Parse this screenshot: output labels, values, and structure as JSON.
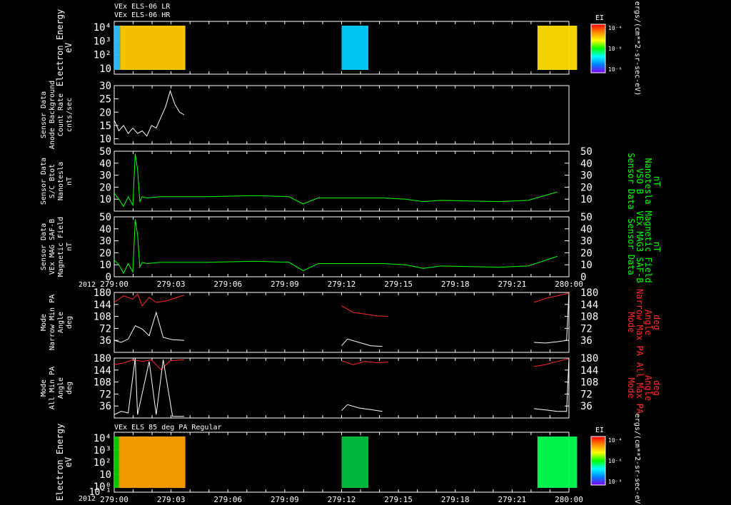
{
  "header": {
    "line1": "VEx ELS-06 LR",
    "line2": "VEx ELS-06 HR"
  },
  "bottom_title": "VEx ELS 85 deg PA Regular",
  "year_label": "2012",
  "time_ticks": [
    "279:00",
    "279:03",
    "279:06",
    "279:09",
    "279:12",
    "279:15",
    "279:18",
    "279:21",
    "280:00"
  ],
  "colorbar": {
    "title": "EI",
    "top_ticks": [
      "10⁻⁴",
      "10⁻⁶",
      "10⁻⁸"
    ],
    "bottom_ticks": [
      "10⁻⁴",
      "10⁻⁶",
      "10⁻⁸"
    ],
    "unit_label": "ergs/(cm**2-sr-sec-eV)",
    "colors": [
      "#ff0000",
      "#ff8800",
      "#ffff00",
      "#00ff00",
      "#00ffff",
      "#0080ff",
      "#8000ff"
    ]
  },
  "colors": {
    "background": "#000000",
    "axes": "#ffffff",
    "green_trace": "#00ff00",
    "red_trace": "#ff2a2a",
    "white_trace": "#ffffff"
  },
  "chart_data": [
    {
      "id": "p1",
      "type": "heatmap",
      "ylabel_lines": [
        "Electron Energy",
        "eV"
      ],
      "yticks": [
        "10⁴",
        "10³",
        "10²",
        "10"
      ],
      "ylim": [
        1,
        20000
      ],
      "yscale": "log",
      "blocks": [
        {
          "x": [
            279.0,
            279.005
          ],
          "color": "#30c0ff"
        },
        {
          "x": [
            279.005,
            279.061
          ],
          "color": "#ffcc00"
        },
        {
          "x": [
            279.195,
            279.218
          ],
          "color": "#00d0ff"
        },
        {
          "x": [
            279.363,
            279.397
          ],
          "color": "#ffdd00"
        }
      ]
    },
    {
      "id": "p2",
      "type": "line",
      "ylabel_lines": [
        "Sensor Data",
        "Anode Background",
        "Count Rate",
        "cnts/sec"
      ],
      "yticks": [
        "30",
        "25",
        "20",
        "15",
        "10"
      ],
      "ylim": [
        8,
        30
      ],
      "series": [
        {
          "color": "white",
          "x": [
            0.0,
            0.004,
            0.008,
            0.012,
            0.016,
            0.02,
            0.024,
            0.028,
            0.032,
            0.036,
            0.04,
            0.044,
            0.048,
            0.052,
            0.056,
            0.06
          ],
          "y": [
            17,
            13,
            15,
            12,
            14,
            12,
            13,
            11,
            15,
            14,
            18,
            22,
            28,
            23,
            20,
            19
          ]
        }
      ]
    },
    {
      "id": "p3",
      "type": "line",
      "ylabel_lines": [
        "Sensor Data",
        "S/C Btot",
        "Nanotesla",
        "nT"
      ],
      "right_label_lines": [
        "Sensor Data",
        "VSO B",
        "Nanotesla",
        "nT"
      ],
      "yticks": [
        "50",
        "40",
        "30",
        "20",
        "10"
      ],
      "ylim": [
        0,
        50
      ],
      "series": [
        {
          "color": "green",
          "x": [
            0.0,
            0.004,
            0.008,
            0.012,
            0.016,
            0.018,
            0.02,
            0.022,
            0.024,
            0.028,
            0.04,
            0.08,
            0.12,
            0.15,
            0.162,
            0.175,
            0.2,
            0.23,
            0.25,
            0.265,
            0.28,
            0.33,
            0.355,
            0.38
          ],
          "y": [
            15,
            10,
            4,
            12,
            5,
            48,
            35,
            8,
            12,
            11,
            12,
            12,
            13,
            12,
            6,
            11,
            11,
            11,
            10,
            8,
            9,
            8,
            9,
            16
          ]
        }
      ]
    },
    {
      "id": "p4",
      "type": "line",
      "ylabel_lines": [
        "Sensor Data",
        "VEx MAG SAF-B",
        "Magnetic Field",
        "nT"
      ],
      "right_label_lines": [
        "Sensor Data",
        "VEx MAG3 SAF-B",
        "Magnetic Field",
        "nT"
      ],
      "yticks": [
        "50",
        "40",
        "30",
        "20",
        "10",
        "0"
      ],
      "ylim": [
        0,
        50
      ],
      "series": [
        {
          "color": "green",
          "x": [
            0.0,
            0.004,
            0.008,
            0.012,
            0.016,
            0.018,
            0.02,
            0.022,
            0.024,
            0.028,
            0.04,
            0.08,
            0.12,
            0.15,
            0.162,
            0.175,
            0.2,
            0.23,
            0.25,
            0.265,
            0.28,
            0.33,
            0.355,
            0.38
          ],
          "y": [
            14,
            10,
            3,
            11,
            4,
            48,
            35,
            8,
            12,
            11,
            12,
            12,
            13,
            12,
            5,
            11,
            11,
            11,
            10,
            7,
            9,
            8,
            9,
            17
          ]
        }
      ]
    },
    {
      "id": "p5",
      "type": "line",
      "ylabel_lines": [
        "Mode",
        "Narrow Min PA",
        "Angle",
        "deg"
      ],
      "right_label_lines": [
        "Mode",
        "Narrow Max PA",
        "Angle",
        "deg"
      ],
      "yticks": [
        "180",
        "144",
        "108",
        "72",
        "36"
      ],
      "ylim": [
        0,
        180
      ],
      "series": [
        {
          "color": "red",
          "x": [
            0.0,
            0.008,
            0.016,
            0.02,
            0.024,
            0.03,
            0.036,
            0.045,
            0.06
          ],
          "y": [
            150,
            170,
            160,
            175,
            140,
            165,
            150,
            155,
            172
          ]
        },
        {
          "color": "red",
          "x": [
            0.195,
            0.205,
            0.215,
            0.225,
            0.235
          ],
          "y": [
            140,
            120,
            115,
            110,
            108
          ]
        },
        {
          "color": "red",
          "x": [
            0.36,
            0.37,
            0.38,
            0.39
          ],
          "y": [
            150,
            162,
            170,
            178
          ]
        },
        {
          "color": "white",
          "x": [
            0.0,
            0.006,
            0.012,
            0.018,
            0.024,
            0.03,
            0.036,
            0.042,
            0.05,
            0.06
          ],
          "y": [
            36,
            30,
            40,
            80,
            70,
            50,
            120,
            45,
            38,
            36
          ]
        },
        {
          "color": "white",
          "x": [
            0.195,
            0.2,
            0.21,
            0.22,
            0.23
          ],
          "y": [
            20,
            40,
            30,
            20,
            18
          ]
        },
        {
          "color": "white",
          "x": [
            0.36,
            0.37,
            0.38,
            0.388,
            0.39
          ],
          "y": [
            30,
            28,
            32,
            36,
            178
          ]
        }
      ]
    },
    {
      "id": "p6",
      "type": "line",
      "ylabel_lines": [
        "Mode",
        "All Min PA",
        "Angle",
        "deg"
      ],
      "right_label_lines": [
        "Mode",
        "All Max PA",
        "Angle",
        "deg"
      ],
      "yticks": [
        "180",
        "144",
        "108",
        "72",
        "36"
      ],
      "ylim": [
        0,
        180
      ],
      "series": [
        {
          "color": "red",
          "x": [
            0.0,
            0.008,
            0.016,
            0.024,
            0.032,
            0.04,
            0.048,
            0.06
          ],
          "y": [
            160,
            165,
            175,
            170,
            175,
            145,
            172,
            175
          ]
        },
        {
          "color": "red",
          "x": [
            0.195,
            0.205,
            0.215,
            0.225,
            0.235
          ],
          "y": [
            172,
            160,
            170,
            166,
            168
          ]
        },
        {
          "color": "red",
          "x": [
            0.36,
            0.37,
            0.38,
            0.39
          ],
          "y": [
            155,
            160,
            170,
            178
          ]
        },
        {
          "color": "white",
          "x": [
            0.0,
            0.006,
            0.012,
            0.018,
            0.02,
            0.03,
            0.036,
            0.042,
            0.05,
            0.06
          ],
          "y": [
            10,
            20,
            15,
            180,
            10,
            170,
            10,
            175,
            5,
            5
          ]
        },
        {
          "color": "white",
          "x": [
            0.195,
            0.2,
            0.21,
            0.22,
            0.23
          ],
          "y": [
            22,
            40,
            30,
            25,
            20
          ]
        },
        {
          "color": "white",
          "x": [
            0.36,
            0.37,
            0.38,
            0.388,
            0.39
          ],
          "y": [
            28,
            24,
            20,
            20,
            178
          ]
        }
      ]
    },
    {
      "id": "p7",
      "type": "heatmap",
      "ylabel_lines": [
        "Electron Energy",
        "eV"
      ],
      "yticks": [
        "10⁴",
        "10³",
        "10²",
        "10",
        "10⁰"
      ],
      "xmin_label": "10⁻¹",
      "ylim": [
        0.1,
        20000
      ],
      "yscale": "log",
      "blocks": [
        {
          "x": [
            279.0,
            279.004
          ],
          "color": "#00d000"
        },
        {
          "x": [
            279.004,
            279.061
          ],
          "color": "#ffa000"
        },
        {
          "x": [
            279.195,
            279.218
          ],
          "color": "#00c040"
        },
        {
          "x": [
            279.363,
            279.397
          ],
          "color": "#00ff50"
        }
      ]
    }
  ]
}
